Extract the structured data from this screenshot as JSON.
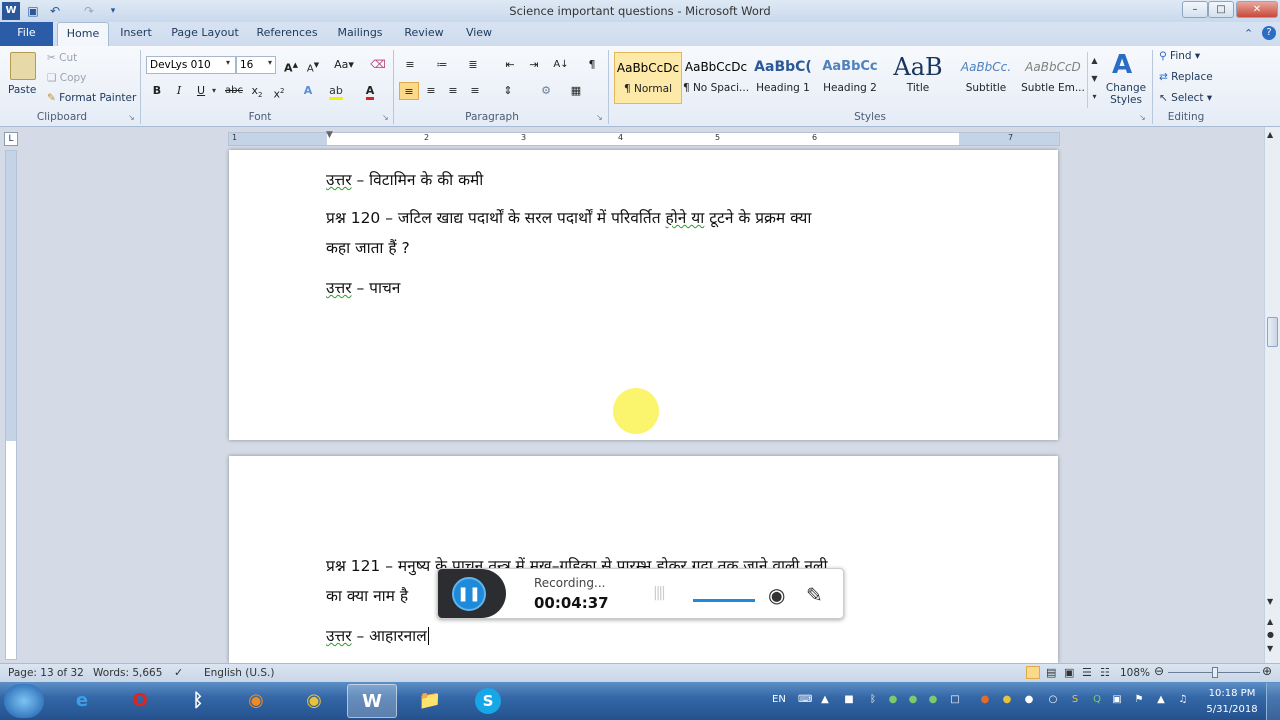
{
  "window": {
    "title": "Science important questions - Microsoft Word",
    "minimize": "–",
    "maximize": "□",
    "close": "✕"
  },
  "tabs": [
    "File",
    "Home",
    "Insert",
    "Page Layout",
    "References",
    "Mailings",
    "Review",
    "View"
  ],
  "clipboard": {
    "paste": "Paste",
    "cut": "Cut",
    "copy": "Copy",
    "format_painter": "Format Painter",
    "label": "Clipboard"
  },
  "font": {
    "name": "DevLys 010",
    "size": "16",
    "label": "Font"
  },
  "paragraph": {
    "label": "Paragraph"
  },
  "styles": {
    "items": [
      {
        "preview": "AaBbCcDc",
        "name": "¶ Normal"
      },
      {
        "preview": "AaBbCcDc",
        "name": "¶ No Spaci..."
      },
      {
        "preview": "AaBbC(",
        "name": "Heading 1"
      },
      {
        "preview": "AaBbCc",
        "name": "Heading 2"
      },
      {
        "preview": "AaB",
        "name": "Title"
      },
      {
        "preview": "AaBbCc.",
        "name": "Subtitle"
      },
      {
        "preview": "AaBbCcD",
        "name": "Subtle Em..."
      }
    ],
    "change_styles": "Change Styles",
    "label": "Styles"
  },
  "editing": {
    "find": "Find",
    "replace": "Replace",
    "select": "Select",
    "label": "Editing"
  },
  "ruler_marks": [
    "1",
    "2",
    "3",
    "4",
    "5",
    "6",
    "7"
  ],
  "document": {
    "page1": {
      "line1_label": "उत्तर",
      "line1_text": " – विटामिन के की कमी",
      "q120_a": "प्रश्न 120 – जटिल खाद्य पदार्थों के सरल पदार्थों में परिवर्तित ",
      "q120_b": "होने या",
      "q120_c": " टूटने के प्रक्रम क्या",
      "q120_line2": "कहा जाता हैं ?",
      "ans_label": "उत्तर",
      "ans_text": " – पाचन"
    },
    "page2": {
      "q121_line1": "प्रश्न 121 – मनुष्य के पाचन तन्त्र में मुख–गुहिका से प्रारम्भ होकर गुदा तक जाने वाली नली",
      "q121_line2": "का क्या नाम है",
      "ans_label": "उत्तर",
      "ans_text": " – आहारनाल"
    }
  },
  "recorder": {
    "status": "Recording...",
    "time": "00:04:37"
  },
  "statusbar": {
    "page": "Page: 13 of 32",
    "words": "Words: 5,665",
    "language": "English (U.S.)",
    "zoom": "108%"
  },
  "taskbar": {
    "language": "EN",
    "time": "10:18 PM",
    "date": "5/31/2018"
  }
}
